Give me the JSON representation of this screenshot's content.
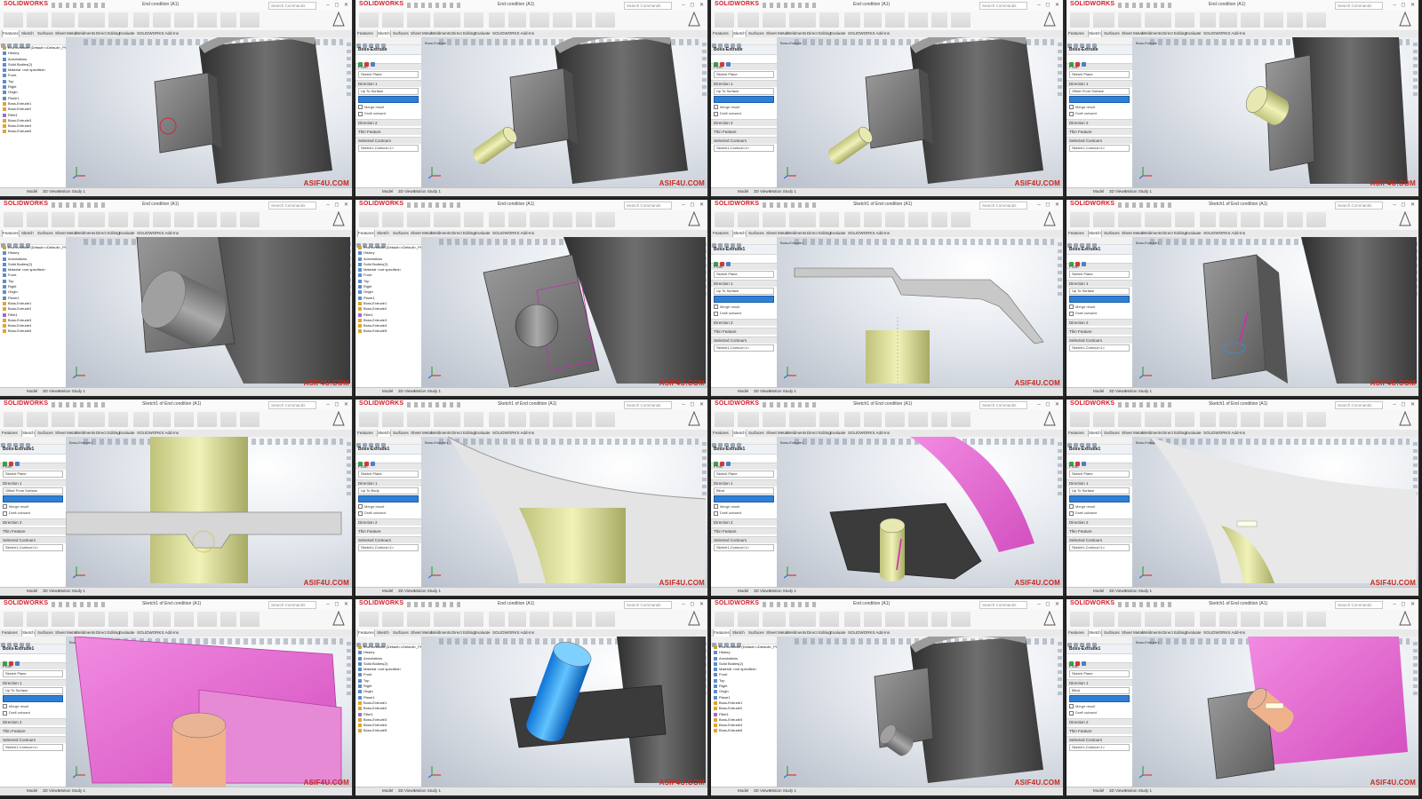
{
  "app": {
    "logo_text": "SOLIDWORKS",
    "search_placeholder": "Search Commands",
    "window_controls": "– ◻ ✕",
    "watermark_text": "ASIF4U",
    "watermark_domain": ".COM"
  },
  "tabs": [
    "Features",
    "Sketch",
    "Surfaces",
    "Sheet Metal",
    "Weldments",
    "Direct Editing",
    "Evaluate",
    "SOLIDWORKS Add-Ins"
  ],
  "model_tabs": [
    "Model",
    "3D Views",
    "Motion Study 1"
  ],
  "colors": {
    "accent": "#d41f2b",
    "selection_blue": "#2f7fd6",
    "preview_yellow": "#dfe29a",
    "preview_pink": "#e85fd0",
    "body_dark": "#4a4a4a",
    "body_grey": "#8f8f8f"
  },
  "panels": [
    {
      "id": 1,
      "title": "End condition (A1)",
      "sidebar": "tree",
      "header": "End condition (Default<<Default>_Phot",
      "scene": "block_plate"
    },
    {
      "id": 2,
      "title": "End condition (A1)",
      "sidebar": "pm",
      "header": "Boss-Extrude",
      "scene": "block_plate_cyl"
    },
    {
      "id": 3,
      "title": "End condition (A1)",
      "sidebar": "pm",
      "header": "Boss-Extrude",
      "scene": "block_plate_cyl"
    },
    {
      "id": 4,
      "title": "End condition (A1)",
      "sidebar": "pm",
      "header": "Boss-Extrude",
      "scene": "block_cyl_front"
    },
    {
      "id": 5,
      "title": "End condition (A1)",
      "sidebar": "tree",
      "header": "End condition (Default<<Default>_Phot",
      "scene": "cyl_closeup"
    },
    {
      "id": 6,
      "title": "End condition (A1)",
      "sidebar": "tree",
      "header": "End condition (Default<<Default>_Phot",
      "scene": "cyl_face"
    },
    {
      "id": 7,
      "title": "Sketch1 of End condition (A1)",
      "sidebar": "pm",
      "header": "Boss-Extrude1",
      "scene": "sketch_profile"
    },
    {
      "id": 8,
      "title": "Sketch1 of End condition (A1)",
      "sidebar": "pm",
      "header": "Boss-Extrude1",
      "scene": "plate_arrow"
    },
    {
      "id": 9,
      "title": "Sketch1 of End condition (A1)",
      "sidebar": "pm",
      "header": "Boss-Extrude1",
      "scene": "yellow_cyl_top"
    },
    {
      "id": 10,
      "title": "Sketch1 of End condition (A1)",
      "sidebar": "pm",
      "header": "Boss-Extrude1",
      "scene": "curve_yellow"
    },
    {
      "id": 11,
      "title": "Sketch1 of End condition (A1)",
      "sidebar": "pm",
      "header": "Boss-Extrude1",
      "scene": "pink_surface"
    },
    {
      "id": 12,
      "title": "Sketch1 of End condition (A1)",
      "sidebar": "pm",
      "header": "Boss-Extrude1",
      "scene": "curve_pick"
    },
    {
      "id": 13,
      "title": "Sketch1 of End condition (A1)",
      "sidebar": "pm",
      "header": "Boss-Extrude1",
      "scene": "pink_plate"
    },
    {
      "id": 14,
      "title": "End condition (A1)",
      "sidebar": "tree",
      "header": "End condition (Default<<Default>_Phot",
      "scene": "blue_cyl"
    },
    {
      "id": 15,
      "title": "End condition (A1)",
      "sidebar": "tree",
      "header": "End condition (Default<<Default>_Phot",
      "scene": "block_plate_stub"
    },
    {
      "id": 16,
      "title": "Sketch1 of End condition (A1)",
      "sidebar": "pm",
      "header": "Boss-Extrude1",
      "scene": "pink_block"
    }
  ],
  "feature_tree": [
    "End condition (Default<<Default>_Phot",
    "History",
    "Annotations",
    "Solid Bodies(2)",
    "Material <not specified>",
    "Front",
    "Top",
    "Right",
    "Origin",
    "Plane1",
    "Boss-Extrude1",
    "Boss-Extrude2",
    "Fillet1",
    "Boss-Extrude3",
    "Boss-Extrude4",
    "Boss-Extrude5"
  ],
  "property_manager": {
    "from_label": "From",
    "from_value": "Sketch Plane",
    "direction1_label": "Direction 1",
    "end_condition_values": [
      "Blind",
      "Up To Surface",
      "Up To Surface",
      "Offset From Surface",
      "Up To Body"
    ],
    "merge_result": "Merge result",
    "draft_outward": "Draft outward",
    "direction2": "Direction 2",
    "thin_feature": "Thin Feature",
    "selected_contours": "Selected Contours",
    "contour_item": "Sketch1-Contour<1>"
  }
}
